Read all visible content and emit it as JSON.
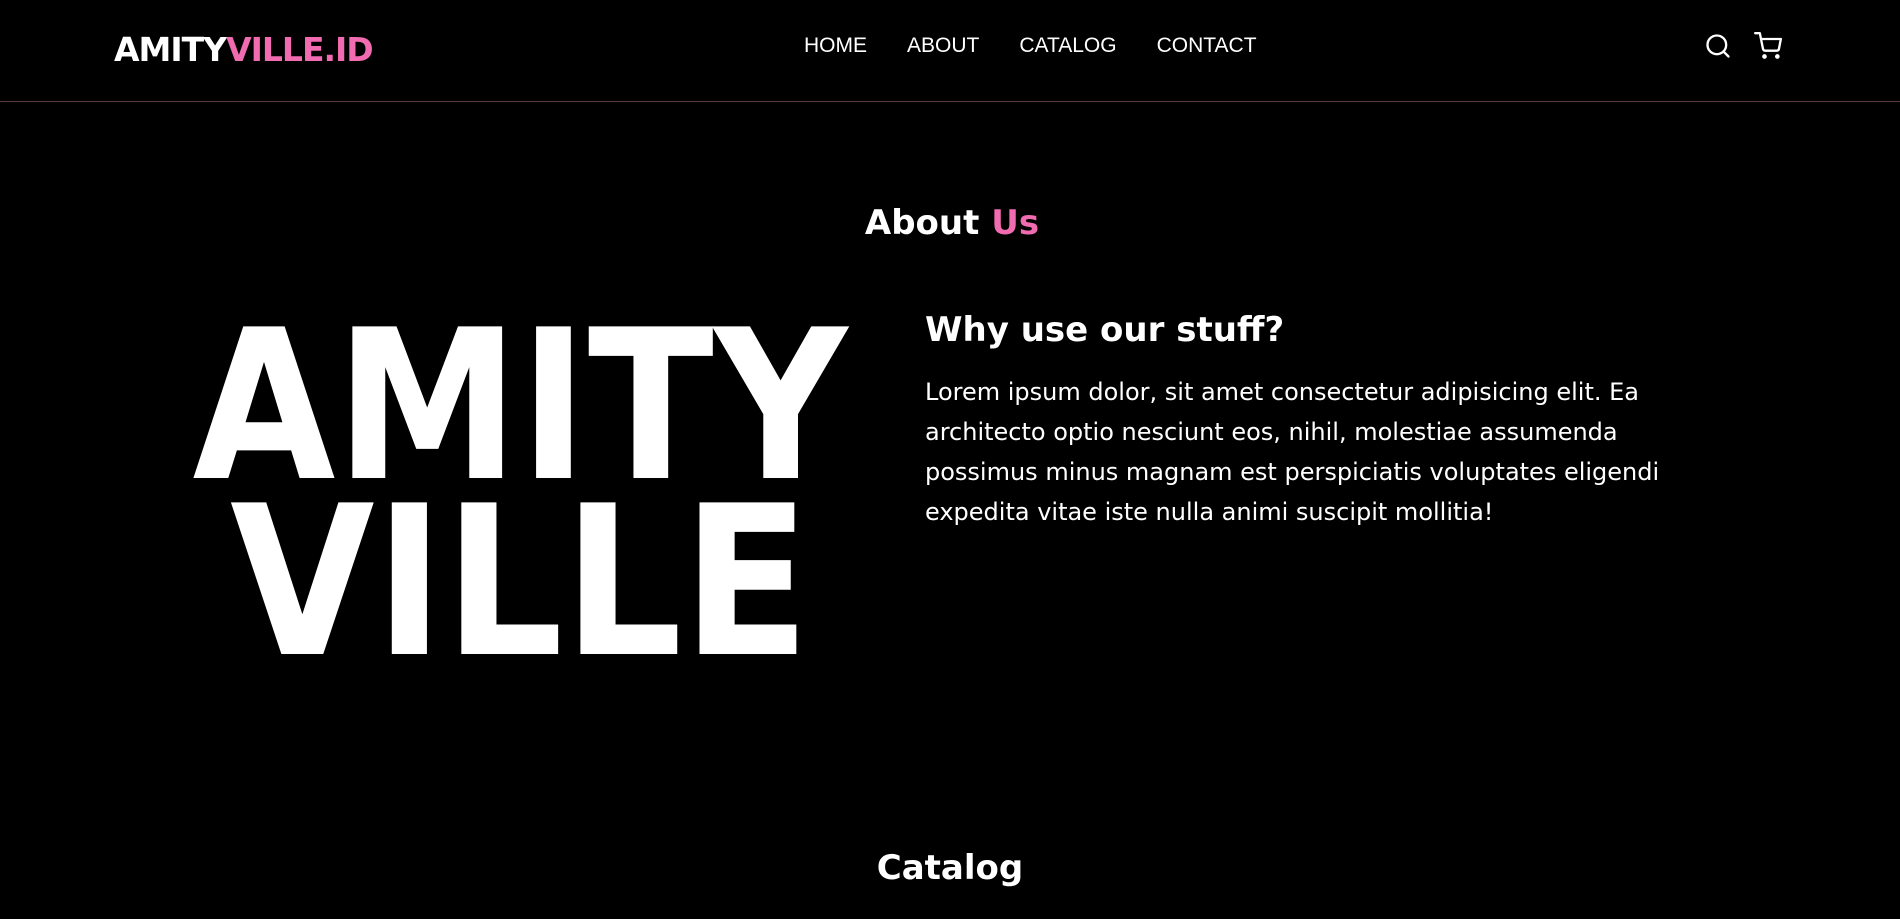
{
  "brand": {
    "name_part1": "AMITY",
    "name_part2": "VILLE.ID",
    "accent_color": "#f06bb0"
  },
  "nav": {
    "links": [
      "HOME",
      "ABOUT",
      "CATALOG",
      "CONTACT"
    ],
    "icons": [
      "search-icon",
      "cart-icon"
    ]
  },
  "about": {
    "title_part1": "About",
    "title_part2": "Us",
    "logo_line1": "AMITY",
    "logo_line2": "VILLE",
    "heading": "Why use our stuff?",
    "text": "Lorem ipsum dolor, sit amet consectetur adipisicing elit. Ea architecto optio nesciunt eos, nihil, molestiae assumenda possimus minus magnam est perspiciatis voluptates eligendi expedita vitae iste nulla animi suscipit mollitia!"
  },
  "catalog": {
    "title": "Catalog"
  }
}
